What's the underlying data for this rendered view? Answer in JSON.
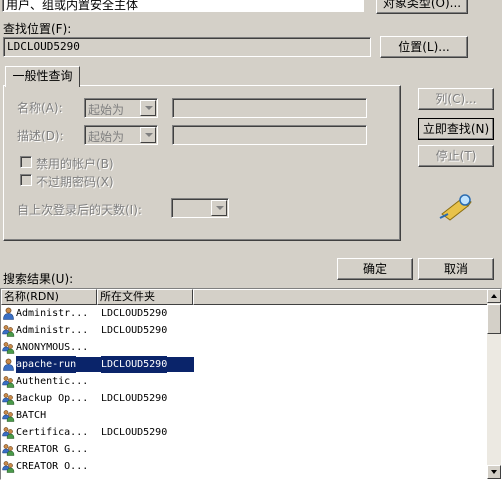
{
  "object_type": {
    "field_value": "用户、组或内置安全主体",
    "button_label": "对象类型(O)..."
  },
  "location": {
    "label": "查找位置(F):",
    "value": "LDCLOUD5290",
    "button_label": "位置(L)..."
  },
  "tab": {
    "label": "一般性查询"
  },
  "query": {
    "name_label": "名称(A):",
    "name_mode": "起始为",
    "desc_label": "描述(D):",
    "desc_mode": "起始为",
    "disabled_accounts_label": "禁用的帐户(B)",
    "no_expire_label": "不过期密码(X)",
    "days_label": "自上次登录后的天数(I):"
  },
  "buttons": {
    "columns": "列(C)...",
    "find_now": "立即查找(N)",
    "stop": "停止(T)",
    "ok": "确定",
    "cancel": "取消"
  },
  "results": {
    "label": "搜索结果(U):",
    "col_name": "名称(RDN)",
    "col_folder": "所在文件夹",
    "rows": [
      {
        "name": "Administr...",
        "folder": "LDCLOUD5290",
        "icon": "user-icon",
        "selected": false
      },
      {
        "name": "Administr...",
        "folder": "LDCLOUD5290",
        "icon": "group-icon",
        "selected": false
      },
      {
        "name": "ANONYMOUS...",
        "folder": "",
        "icon": "group-icon",
        "selected": false
      },
      {
        "name": "apache-run",
        "folder": "LDCLOUD5290",
        "icon": "user-icon",
        "selected": true
      },
      {
        "name": "Authentic...",
        "folder": "",
        "icon": "group-icon",
        "selected": false
      },
      {
        "name": "Backup Op...",
        "folder": "LDCLOUD5290",
        "icon": "group-icon",
        "selected": false
      },
      {
        "name": "BATCH",
        "folder": "",
        "icon": "group-icon",
        "selected": false
      },
      {
        "name": "Certifica...",
        "folder": "LDCLOUD5290",
        "icon": "group-icon",
        "selected": false
      },
      {
        "name": "CREATOR G...",
        "folder": "",
        "icon": "group-icon",
        "selected": false
      },
      {
        "name": "CREATOR O...",
        "folder": "",
        "icon": "group-icon",
        "selected": false
      }
    ]
  },
  "colors": {
    "selection": "#0a246a",
    "dialog_bg": "#d4d0c8"
  }
}
